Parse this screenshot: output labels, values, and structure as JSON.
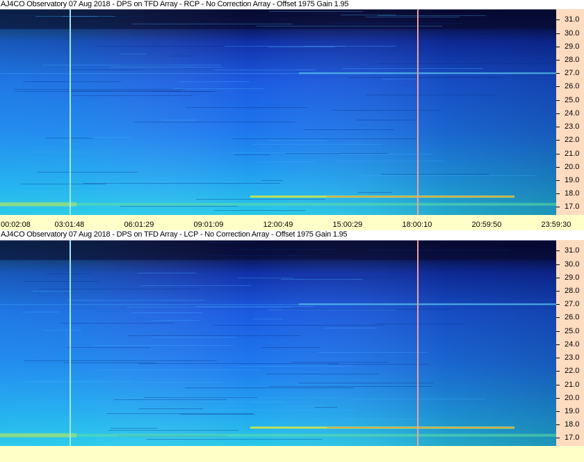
{
  "panels": [
    {
      "title": "AJ4CO Observatory 07 Aug 2018 - DPS on TFD Array  - RCP  -  No Correction Array  -  Offset 1975  Gain 1.95",
      "polarization": "RCP"
    },
    {
      "title": "AJ4CO Observatory 07 Aug 2018 - DPS on TFD Array  - LCP  -  No Correction Array  -  Offset 1975  Gain 1.95",
      "polarization": "LCP"
    }
  ],
  "chart_data": {
    "type": "heatmap",
    "xlabel": "",
    "ylabel": "",
    "x_tick_labels": [
      "00:02:08",
      "03:01:48",
      "06:01:29",
      "09:01:09",
      "12:00:49",
      "15:00:29",
      "18:00:10",
      "20:59:50",
      "23:59:30"
    ],
    "y_tick_labels": [
      "31.0",
      "30.0",
      "29.0",
      "28.0",
      "27.0",
      "26.0",
      "25.0",
      "24.0",
      "23.0",
      "22.0",
      "21.0",
      "20.0",
      "19.0",
      "18.0",
      "17.0"
    ],
    "y_ticks": [
      31.0,
      30.0,
      29.0,
      28.0,
      27.0,
      26.0,
      25.0,
      24.0,
      23.0,
      22.0,
      21.0,
      20.0,
      19.0,
      18.0,
      17.0
    ],
    "ylim": [
      16.4,
      31.8
    ],
    "colors": {
      "low": "#0a1050",
      "mid": "#1e6ae8",
      "high": "#22c0f0",
      "hot": "#e0e040",
      "marker_cyan": "#a0e8f0",
      "marker_pink": "#f0a0a0",
      "y_axis_bg": "#ffdcc0",
      "x_axis_bg": "#ffffc8"
    },
    "markers": [
      {
        "time": "03:01:48",
        "color": "#a0e8f0"
      },
      {
        "time": "18:00:10",
        "color": "#f0a0a0"
      }
    ],
    "interference_bands_mhz": [
      27.0,
      17.8,
      17.2
    ]
  }
}
